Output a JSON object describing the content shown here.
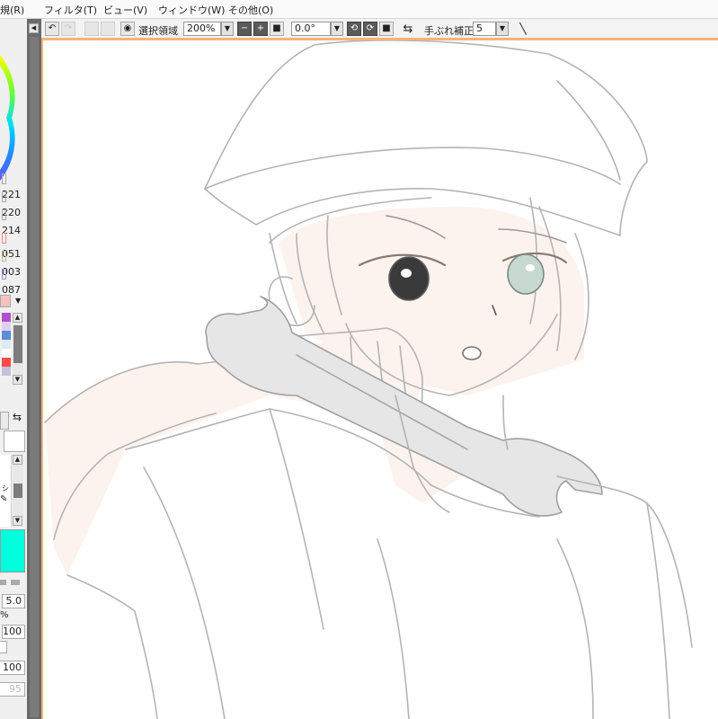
{
  "menu": [
    "規(R)",
    "フィルタ(T)",
    "ビュー(V)",
    "ウィンドウ(W)",
    "その他(O)"
  ],
  "toolbar": {
    "selection_label": "選択領域",
    "zoom_value": "200%",
    "rotation_value": "0.0°",
    "stabilizer_label": "手ぶれ補正",
    "stabilizer_value": "5"
  },
  "left_panel": {
    "hsv_values": [
      "221",
      "220",
      "214"
    ],
    "rgb_values": [
      "051",
      "003",
      "087"
    ],
    "brush_size": "5.0",
    "percent_symbol": "%",
    "density": "100",
    "blend_value": "100",
    "dim_value": "95",
    "brush_name_fragment": "シ"
  },
  "colors": {
    "current_color": "#00ffdd",
    "canvas_border": "#f2b479",
    "swatches": [
      "#b24fcf",
      "#bcbcbc",
      "#5b8fd6",
      "#ffffff",
      "#ff4a4a",
      "#e8c8e8"
    ]
  }
}
